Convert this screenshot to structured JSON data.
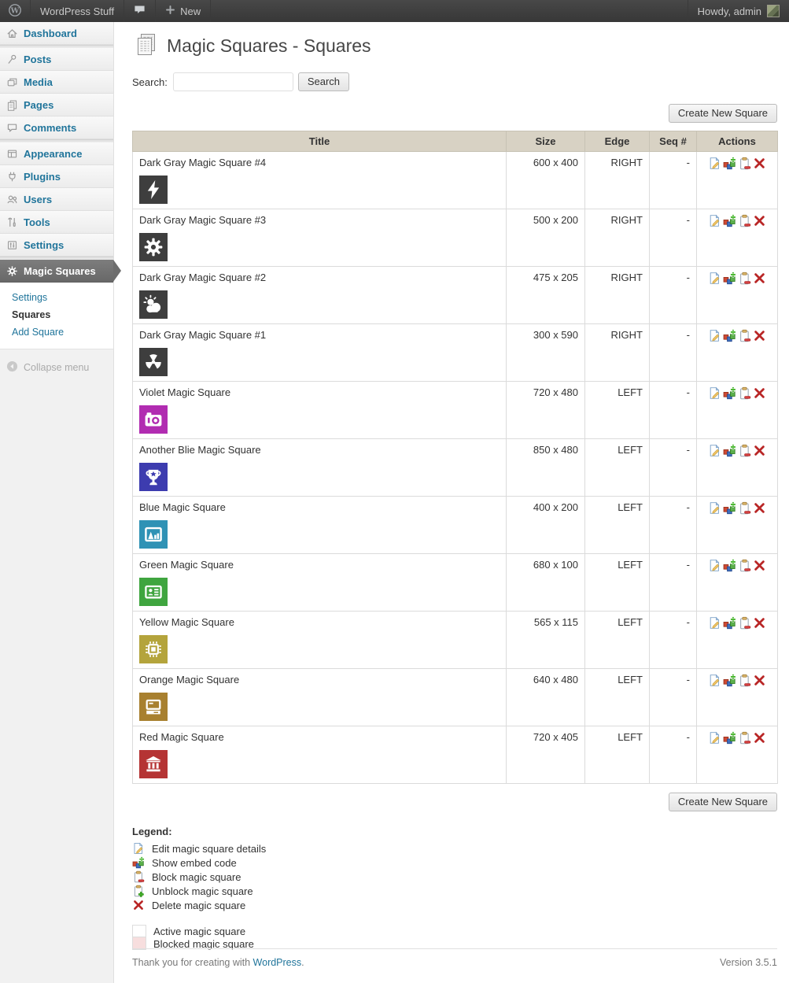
{
  "admin_bar": {
    "site_name": "WordPress Stuff",
    "new_label": "New",
    "howdy": "Howdy, admin"
  },
  "sidebar": {
    "menu": [
      {
        "label": "Dashboard",
        "icon": "home"
      },
      {
        "label": "Posts",
        "icon": "pin",
        "sep_before": true
      },
      {
        "label": "Media",
        "icon": "media"
      },
      {
        "label": "Pages",
        "icon": "pages"
      },
      {
        "label": "Comments",
        "icon": "comments"
      },
      {
        "label": "Appearance",
        "icon": "appearance",
        "sep_before": true
      },
      {
        "label": "Plugins",
        "icon": "plugins"
      },
      {
        "label": "Users",
        "icon": "users"
      },
      {
        "label": "Tools",
        "icon": "tools"
      },
      {
        "label": "Settings",
        "icon": "settings"
      },
      {
        "label": "Magic Squares",
        "icon": "gearwhite",
        "sep_before": true,
        "active": true
      }
    ],
    "submenu": [
      {
        "label": "Settings",
        "current": false
      },
      {
        "label": "Squares",
        "current": true
      },
      {
        "label": "Add Square",
        "current": false
      }
    ],
    "collapse_label": "Collapse menu"
  },
  "page": {
    "title": "Magic Squares - Squares",
    "search_label": "Search:",
    "search_button_label": "Search",
    "search_value": "",
    "create_button_label": "Create New Square"
  },
  "table": {
    "headers": [
      "Title",
      "Size",
      "Edge",
      "Seq #",
      "Actions"
    ],
    "actions": [
      "edit",
      "embed",
      "block",
      "delete"
    ],
    "rows": [
      {
        "title": "Dark Gray Magic Square #4",
        "icon": "lightning",
        "color": "#3e3e3e",
        "size": "600 x 400",
        "edge": "RIGHT",
        "seq": "-"
      },
      {
        "title": "Dark Gray Magic Square #3",
        "icon": "gear",
        "color": "#3e3e3e",
        "size": "500 x 200",
        "edge": "RIGHT",
        "seq": "-"
      },
      {
        "title": "Dark Gray Magic Square #2",
        "icon": "weather",
        "color": "#3e3e3e",
        "size": "475 x 205",
        "edge": "RIGHT",
        "seq": "-"
      },
      {
        "title": "Dark Gray Magic Square #1",
        "icon": "radiation",
        "color": "#3e3e3e",
        "size": "300 x 590",
        "edge": "RIGHT",
        "seq": "-"
      },
      {
        "title": "Violet Magic Square",
        "icon": "camera",
        "color": "#b12cb1",
        "size": "720 x 480",
        "edge": "LEFT",
        "seq": "-"
      },
      {
        "title": "Another Blie Magic Square",
        "icon": "trophy",
        "color": "#3d3caf",
        "size": "850 x 480",
        "edge": "LEFT",
        "seq": "-"
      },
      {
        "title": "Blue Magic Square",
        "icon": "chart",
        "color": "#2f92b5",
        "size": "400 x 200",
        "edge": "LEFT",
        "seq": "-"
      },
      {
        "title": "Green Magic Square",
        "icon": "idcard",
        "color": "#3fa53f",
        "size": "680 x 100",
        "edge": "LEFT",
        "seq": "-"
      },
      {
        "title": "Yellow Magic Square",
        "icon": "chip",
        "color": "#b4a43c",
        "size": "565 x 115",
        "edge": "LEFT",
        "seq": "-"
      },
      {
        "title": "Orange Magic Square",
        "icon": "computer",
        "color": "#a8802f",
        "size": "640 x 480",
        "edge": "LEFT",
        "seq": "-"
      },
      {
        "title": "Red Magic Square",
        "icon": "bank",
        "color": "#b53434",
        "size": "720 x 405",
        "edge": "LEFT",
        "seq": "-"
      }
    ]
  },
  "legend": {
    "title": "Legend:",
    "items": [
      {
        "icon": "edit",
        "label": "Edit magic square details"
      },
      {
        "icon": "embed",
        "label": "Show embed code"
      },
      {
        "icon": "block",
        "label": "Block magic square"
      },
      {
        "icon": "unblock",
        "label": "Unblock magic square"
      },
      {
        "icon": "delete",
        "label": "Delete magic square"
      }
    ],
    "swatches": [
      {
        "color": "#ffffff",
        "label": "Active magic square"
      },
      {
        "color": "#f7dede",
        "label": "Blocked magic square"
      }
    ]
  },
  "footer": {
    "thanks_prefix": "Thank you for creating with ",
    "wordpress_link": "WordPress",
    "thanks_suffix": ".",
    "version": "Version 3.5.1"
  },
  "colors": {
    "accent_link": "#21759b",
    "admin_bar_bg": "#464646",
    "sidebar_active_bg": "#6d6d6d",
    "table_header_bg": "#d8d2c4",
    "blocked_row": "#f7dede"
  }
}
